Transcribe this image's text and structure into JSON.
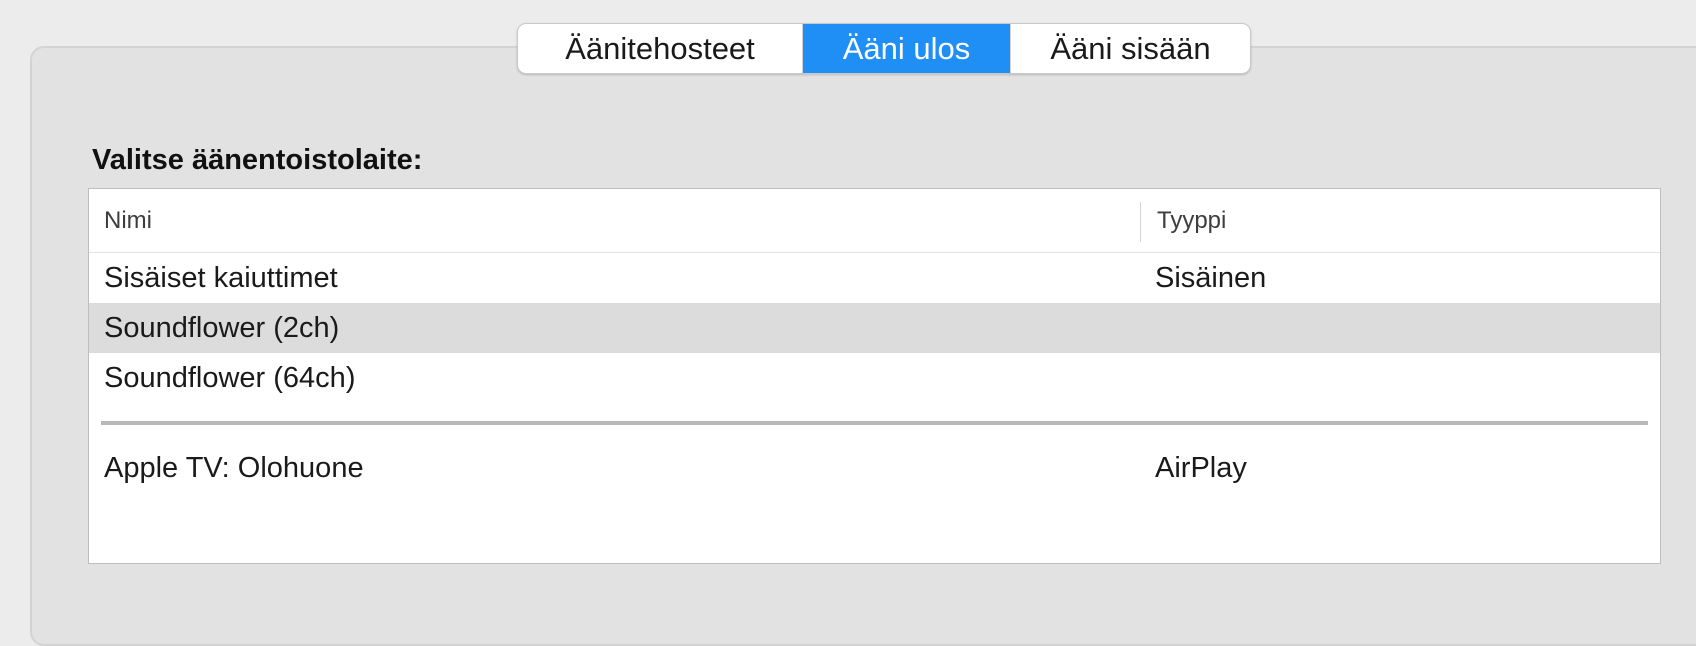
{
  "tabs": [
    {
      "label": "Äänitehosteet",
      "selected": false
    },
    {
      "label": "Ääni ulos",
      "selected": true
    },
    {
      "label": "Ääni sisään",
      "selected": false
    }
  ],
  "heading": "Valitse äänentoistolaite:",
  "table": {
    "columns": [
      "Nimi",
      "Tyyppi"
    ],
    "rows": [
      {
        "name": "Sisäiset kaiuttimet",
        "type": "Sisäinen",
        "selected": false
      },
      {
        "name": "Soundflower (2ch)",
        "type": "",
        "selected": true
      },
      {
        "name": "Soundflower (64ch)",
        "type": "",
        "selected": false
      },
      {
        "name": "Apple TV: Olohuone",
        "type": "AirPlay",
        "selected": false
      }
    ]
  },
  "colors": {
    "accent": "#1f8ff6",
    "selected_row": "#dcdcdc",
    "panel": "#e2e2e2",
    "window": "#ececec"
  }
}
